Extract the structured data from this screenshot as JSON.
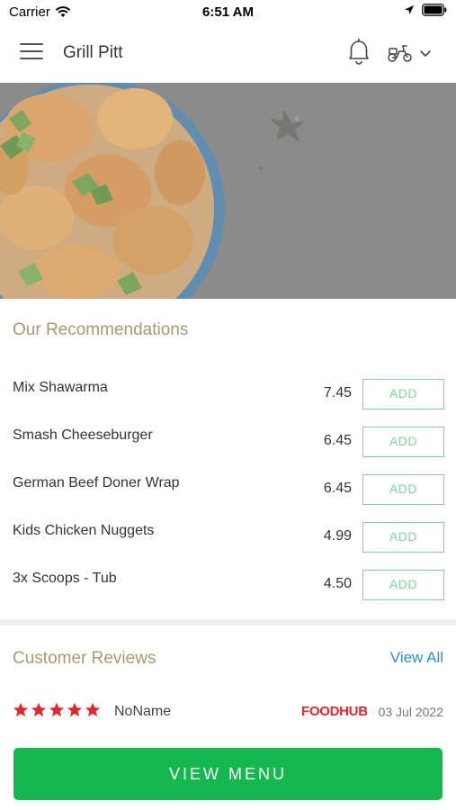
{
  "status_bar": {
    "carrier": "Carrier",
    "time": "6:51 AM"
  },
  "header": {
    "title": "Grill Pitt"
  },
  "recommendations": {
    "title": "Our Recommendations",
    "add_label": "ADD",
    "items": [
      {
        "name": "Mix Shawarma",
        "price": "7.45"
      },
      {
        "name": "Smash Cheeseburger",
        "price": "6.45"
      },
      {
        "name": "German Beef Doner Wrap",
        "price": "6.45"
      },
      {
        "name": "Kids Chicken Nuggets",
        "price": "4.99"
      },
      {
        "name": "3x Scoops - Tub",
        "price": "4.50"
      }
    ]
  },
  "reviews": {
    "title": "Customer Reviews",
    "view_all": "View All",
    "items": [
      {
        "rating": 5,
        "name": "NoName",
        "source": "FOODHUB",
        "date": "03 Jul 2022"
      }
    ]
  },
  "cta": {
    "label": "VIEW MENU"
  },
  "colors": {
    "accent_green": "#14b84e",
    "add_green": "#7fd39b",
    "star_red": "#e3262d",
    "link_blue": "#2f8fd0",
    "section_gold": "#a89a6e"
  }
}
